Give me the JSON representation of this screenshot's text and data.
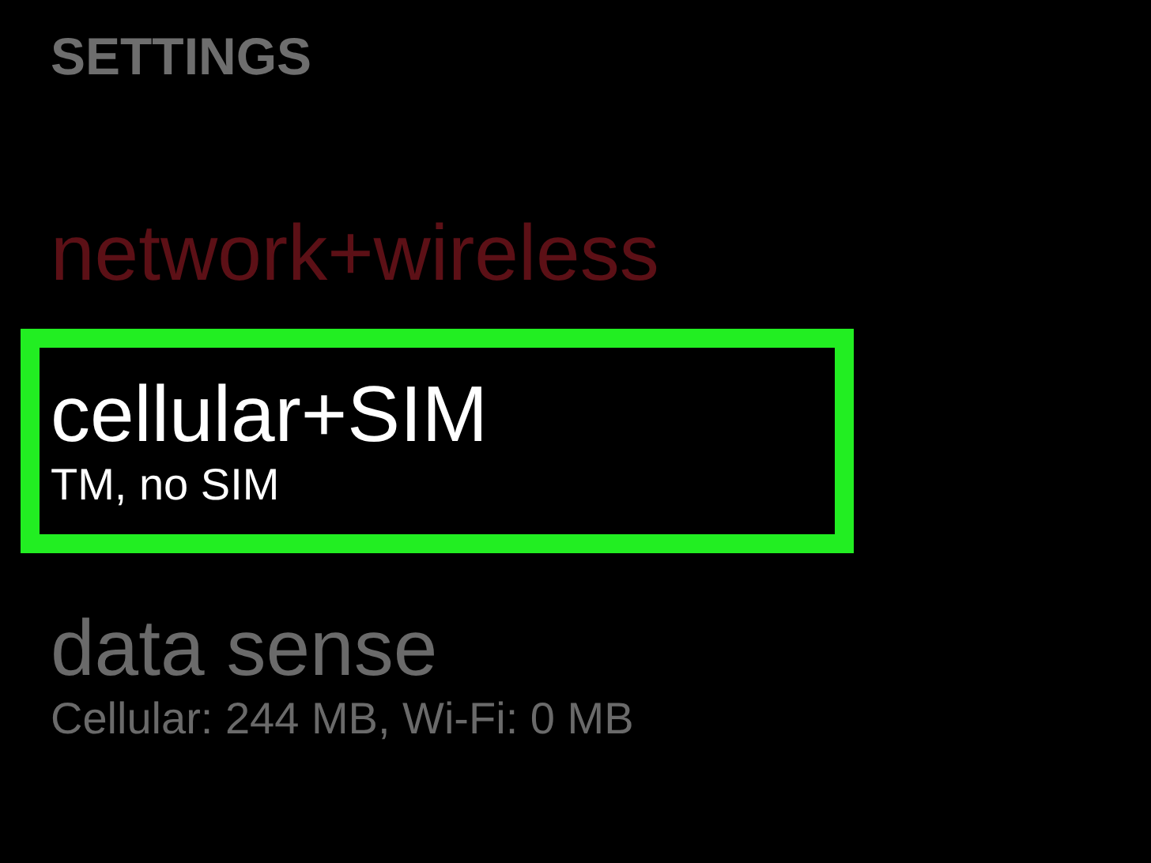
{
  "header": {
    "title": "SETTINGS"
  },
  "items": [
    {
      "title": "network+wireless",
      "color": "#5c1016",
      "highlighted": false
    },
    {
      "title": "cellular+SIM",
      "subtitle": "TM, no SIM",
      "color": "#ffffff",
      "highlighted": true
    },
    {
      "title": "data sense",
      "subtitle": "Cellular: 244 MB, Wi-Fi: 0 MB",
      "color": "#6a6a6a",
      "highlighted": false
    }
  ]
}
